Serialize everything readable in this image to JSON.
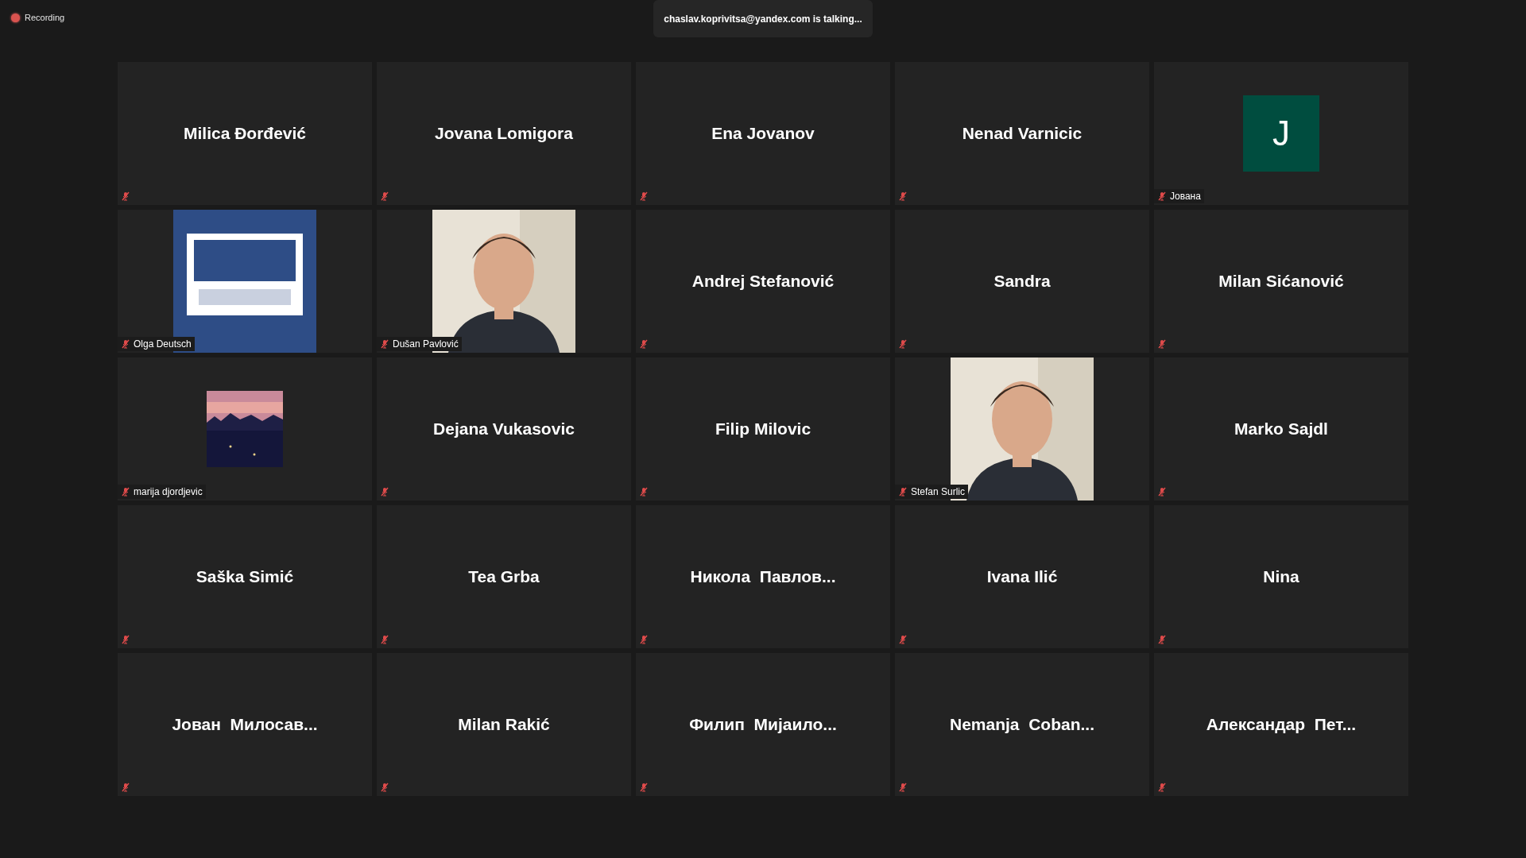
{
  "recording": {
    "label": "Recording"
  },
  "talking_banner": "chaslav.koprivitsa@yandex.com is talking...",
  "tiles": [
    {
      "kind": "name",
      "name": "Milica Đorđević",
      "muted": true
    },
    {
      "kind": "name",
      "name": "Jovana Lomigora",
      "muted": true
    },
    {
      "kind": "name",
      "name": "Ena Jovanov",
      "muted": true
    },
    {
      "kind": "name",
      "name": "Nenad Varnicic",
      "muted": true
    },
    {
      "kind": "initial",
      "initial": "J",
      "label": "Јована",
      "muted": true
    },
    {
      "kind": "picture",
      "label": "Olga Deutsch",
      "muted": true
    },
    {
      "kind": "picture",
      "label": "Dušan Pavlović",
      "muted": true
    },
    {
      "kind": "name",
      "name": "Andrej Stefanović",
      "muted": true
    },
    {
      "kind": "name",
      "name": "Sandra",
      "muted": true
    },
    {
      "kind": "name",
      "name": "Milan Sićanović",
      "muted": true
    },
    {
      "kind": "picture",
      "label": "marija djordjevic",
      "muted": true
    },
    {
      "kind": "name",
      "name": "Dejana Vukasovic",
      "muted": true
    },
    {
      "kind": "name",
      "name": "Filip Milovic",
      "muted": true
    },
    {
      "kind": "picture",
      "label": "Stefan Surlic",
      "muted": true
    },
    {
      "kind": "name",
      "name": "Marko Sajdl",
      "muted": true
    },
    {
      "kind": "name",
      "name": "Saška Simić",
      "muted": true
    },
    {
      "kind": "name",
      "name": "Tea Grba",
      "muted": true
    },
    {
      "kind": "name",
      "name": "Никола  Павлов...",
      "muted": true
    },
    {
      "kind": "name",
      "name": "Ivana Ilić",
      "muted": true
    },
    {
      "kind": "name",
      "name": "Nina",
      "muted": true
    },
    {
      "kind": "name",
      "name": "Јован  Милосав...",
      "muted": true
    },
    {
      "kind": "name",
      "name": "Milan Rakić",
      "muted": true
    },
    {
      "kind": "name",
      "name": "Филип  Мијаило...",
      "muted": true
    },
    {
      "kind": "name",
      "name": "Nemanja  Coban...",
      "muted": true
    },
    {
      "kind": "name",
      "name": "Александар  Пет...",
      "muted": true
    }
  ]
}
